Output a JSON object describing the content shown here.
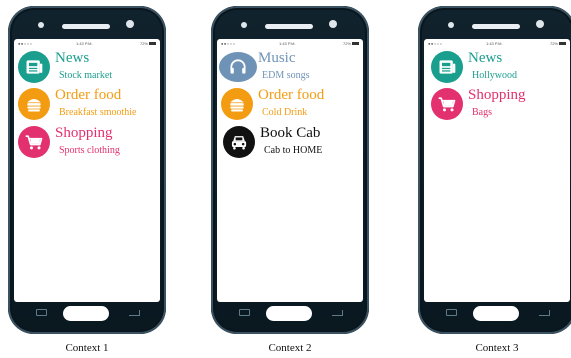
{
  "colors": {
    "news": "#1a9e8e",
    "food": "#f39c12",
    "shopping": "#e3306f",
    "music": "#6f93b7",
    "cab": "#111111"
  },
  "phones": [
    {
      "caption": "Context 1",
      "status": {
        "dots": "●●○○○",
        "time": "1:43 P.M.",
        "battery": "72%"
      },
      "items": [
        {
          "title": "News",
          "subtitle": "Stock market",
          "icon": "newspaper-icon"
        },
        {
          "title": "Order food",
          "subtitle": "Breakfast smoothie",
          "icon": "food-icon"
        },
        {
          "title": "Shopping",
          "subtitle": "Sports clothing",
          "icon": "cart-icon"
        }
      ]
    },
    {
      "caption": "Context 2",
      "status": {
        "dots": "●●○○○",
        "time": "1:43 P.M.",
        "battery": "72%"
      },
      "items": [
        {
          "title": "Music",
          "subtitle": "EDM songs",
          "icon": "headphones-icon"
        },
        {
          "title": "Order food",
          "subtitle": "Cold Drink",
          "icon": "food-icon"
        },
        {
          "title": "Book Cab",
          "subtitle": "Cab to HOME",
          "icon": "car-icon"
        }
      ]
    },
    {
      "caption": "Context 3",
      "status": {
        "dots": "●●○○○",
        "time": "1:43 P.M.",
        "battery": "72%"
      },
      "items": [
        {
          "title": "News",
          "subtitle": "Hollywood",
          "icon": "newspaper-icon"
        },
        {
          "title": "Shopping",
          "subtitle": "Bags",
          "icon": "cart-icon"
        }
      ]
    }
  ]
}
